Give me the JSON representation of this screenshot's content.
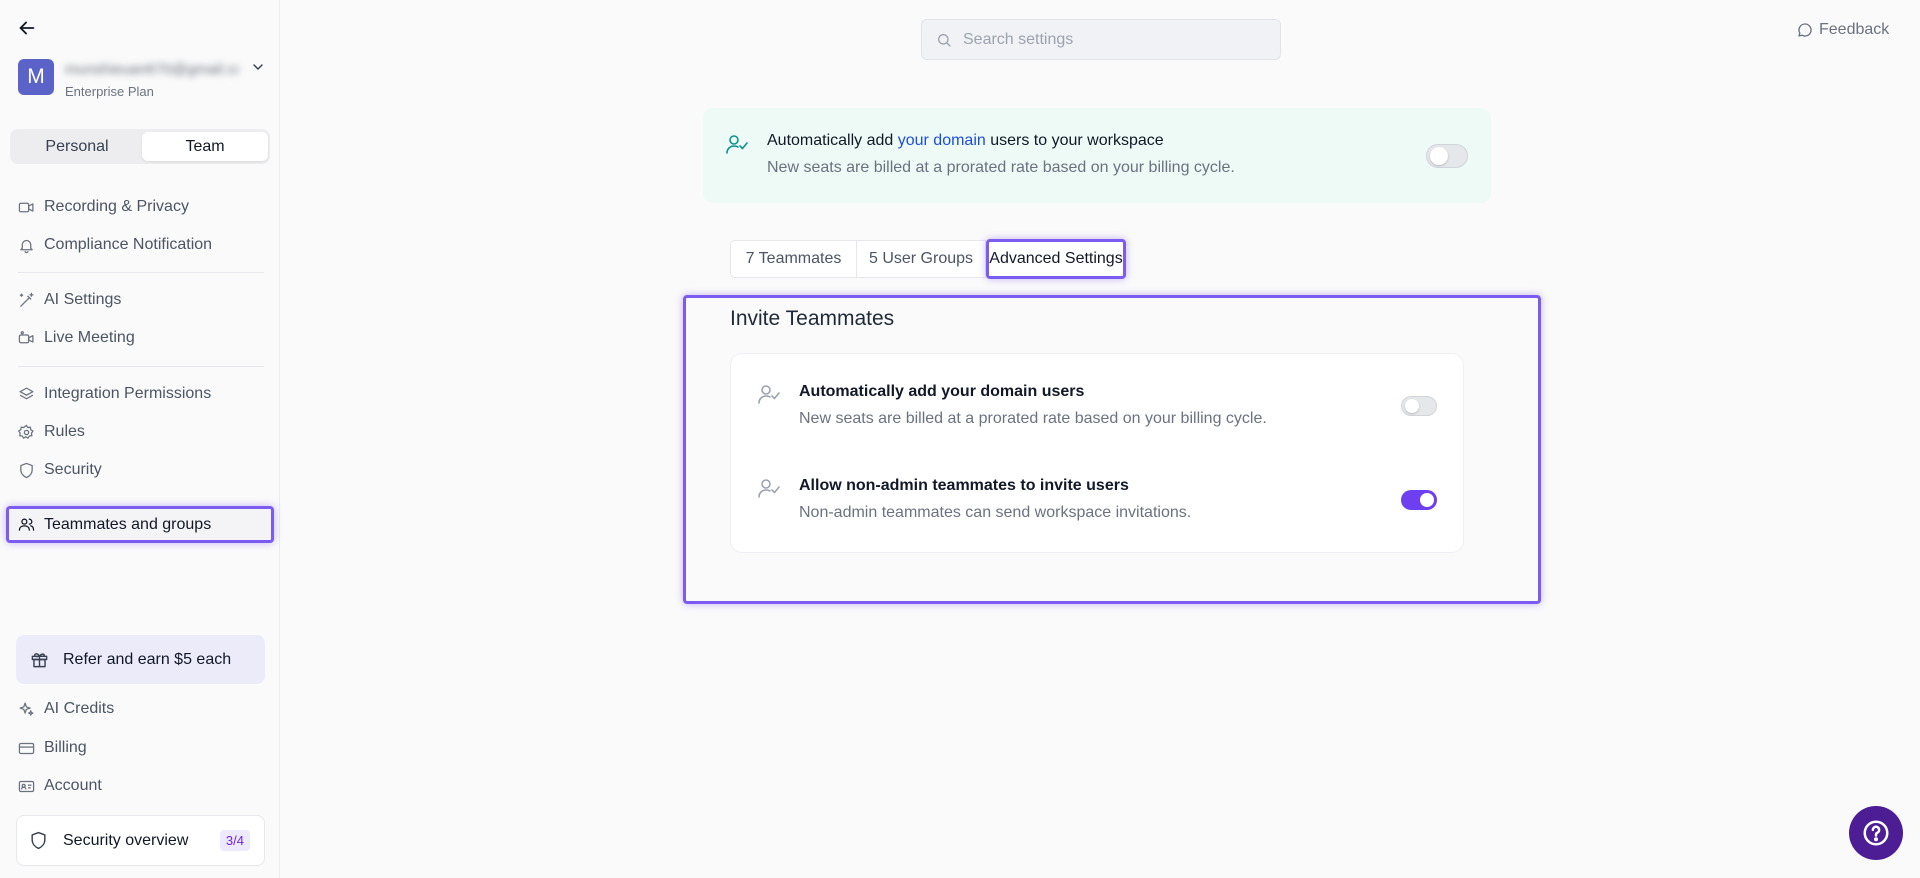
{
  "sidebar": {
    "account": {
      "avatar_letter": "M",
      "email": "munshieuan670@gmail.com",
      "plan": "Enterprise Plan"
    },
    "scope": {
      "personal": "Personal",
      "team": "Team",
      "selected": "Team"
    },
    "nav_group1": [
      {
        "label": "Recording & Privacy",
        "icon": "video-icon"
      },
      {
        "label": "Compliance Notification",
        "icon": "bell-icon"
      }
    ],
    "nav_group2": [
      {
        "label": "AI Settings",
        "icon": "magic-wand-icon"
      },
      {
        "label": "Live Meeting",
        "icon": "video-live-icon"
      }
    ],
    "nav_group3": [
      {
        "label": "Integration Permissions",
        "icon": "layers-icon"
      },
      {
        "label": "Rules",
        "icon": "gear-icon"
      },
      {
        "label": "Security",
        "icon": "shield-icon"
      },
      {
        "label": "Teammates and groups",
        "icon": "users-icon",
        "active": true
      }
    ],
    "refer": {
      "label": "Refer and earn $5 each",
      "icon": "gift-icon"
    },
    "bottom_nav": [
      {
        "label": "AI Credits",
        "icon": "sparkle-icon"
      },
      {
        "label": "Billing",
        "icon": "credit-card-icon"
      },
      {
        "label": "Account",
        "icon": "id-card-icon"
      }
    ],
    "security_overview": {
      "label": "Security overview",
      "badge": "3/4"
    }
  },
  "header": {
    "search_placeholder": "Search settings",
    "feedback_label": "Feedback"
  },
  "banner": {
    "title_prefix": "Automatically add ",
    "title_link": "your domain",
    "title_suffix": " users to your workspace",
    "description": "New seats are billed at a prorated rate based on your billing cycle.",
    "toggle_on": false
  },
  "tabs": [
    {
      "label": "7 Teammates"
    },
    {
      "label": "5 User Groups"
    },
    {
      "label": "Advanced Settings",
      "selected": true
    }
  ],
  "invite_section": {
    "title": "Invite Teammates",
    "rows": [
      {
        "title": "Automatically add your domain users",
        "description": "New seats are billed at a prorated rate based on your billing cycle.",
        "toggle_on": false
      },
      {
        "title": "Allow non-admin teammates to invite users",
        "description": "Non-admin teammates can send workspace invitations.",
        "toggle_on": true
      }
    ]
  },
  "colors": {
    "accent": "#6d3ff1",
    "highlight_border": "#7c5cf0",
    "banner_bg": "#eefaf6",
    "link": "#1d4ed8",
    "help_button": "#4c1d95"
  }
}
